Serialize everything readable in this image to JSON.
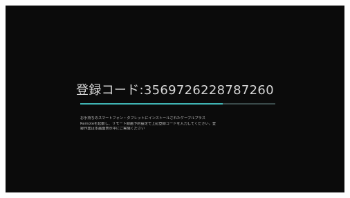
{
  "registration": {
    "label": "登録コード",
    "separator": ":",
    "code": "3569726228787260"
  },
  "progress": {
    "fraction": 0.73,
    "track_color": "#3a4a4a",
    "fill_color": "#3fb3b3"
  },
  "instructions": {
    "lines": [
      "お手持ちのスマートフォン・タブレットにインストールされたケーブルプラス",
      "Remoteを起動し、リモート録画予約設定で上記登録コードを入力してください。登",
      "録作業は本画面表示中にご実施ください"
    ]
  },
  "colors": {
    "screen_background": "#0b0b0b",
    "text": "#d6d6d6",
    "accent": "#3fb3b3"
  }
}
